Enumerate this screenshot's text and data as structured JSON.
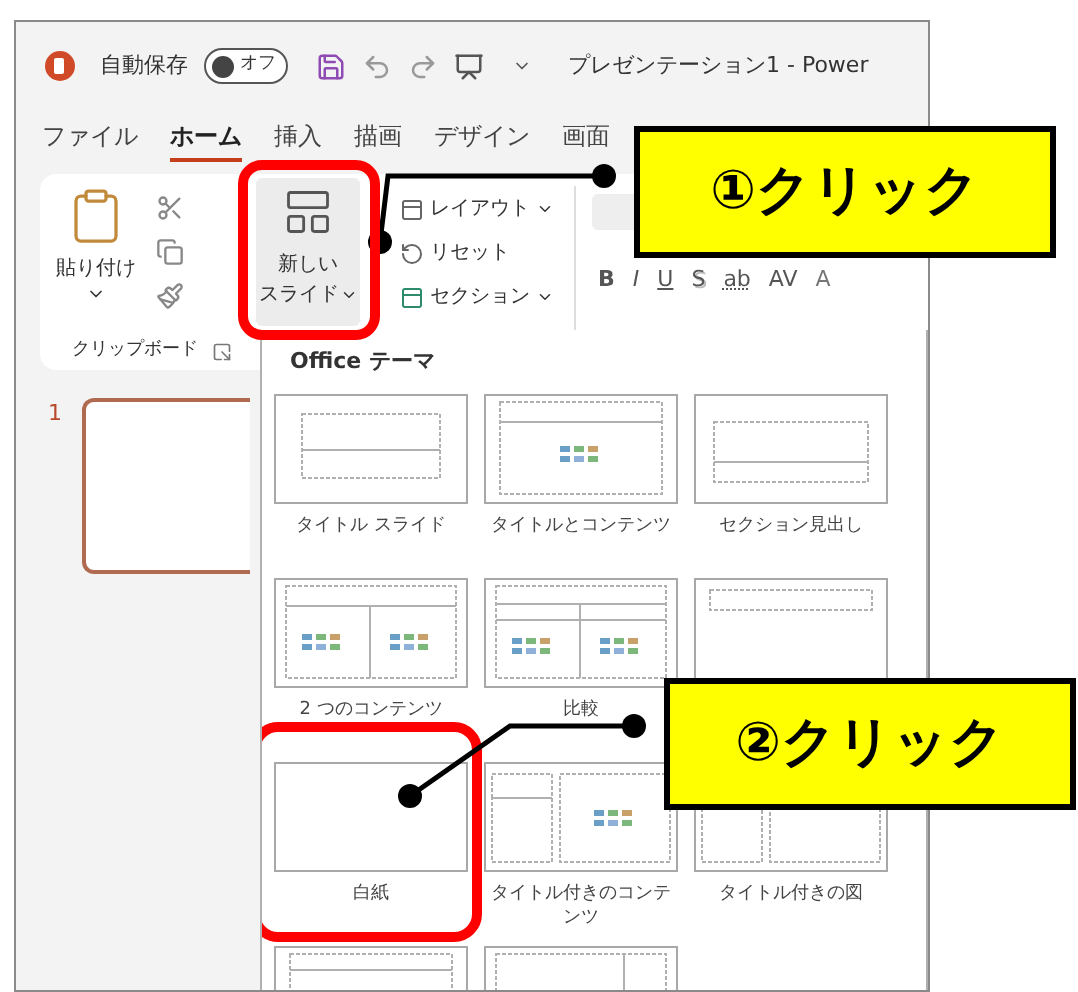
{
  "title_bar": {
    "autosave_label": "自動保存",
    "autosave_toggle": {
      "label": "オフ",
      "on": false
    },
    "document_title": "プレゼンテーション1 - Power"
  },
  "tabs": [
    {
      "label": "ファイル",
      "selected": false
    },
    {
      "label": "ホーム",
      "selected": true
    },
    {
      "label": "挿入",
      "selected": false
    },
    {
      "label": "描画",
      "selected": false
    },
    {
      "label": "デザイン",
      "selected": false
    },
    {
      "label": "画面",
      "selected": false
    }
  ],
  "clipboard_group": {
    "paste_label": "貼り付け",
    "group_label": "クリップボード"
  },
  "slides_group": {
    "new_slide": {
      "label_lines": [
        "新しい",
        "スライド"
      ],
      "highlighted": true
    },
    "commands": [
      {
        "label": "レイアウト",
        "dropdown": true
      },
      {
        "label": "リセット",
        "dropdown": false
      },
      {
        "label": "セクション",
        "dropdown": true
      }
    ]
  },
  "font_group": {
    "buttons": [
      {
        "label": "B",
        "kind": "bold"
      },
      {
        "label": "I",
        "kind": "italic"
      },
      {
        "label": "U",
        "kind": "underline"
      },
      {
        "label": "S",
        "kind": "shadow"
      },
      {
        "label": "ab",
        "kind": "strikethrough"
      },
      {
        "label": "AV",
        "kind": "spacing"
      },
      {
        "label": "A",
        "kind": "color"
      }
    ]
  },
  "slide_pane": {
    "slides": [
      {
        "number": "1",
        "selected": true
      }
    ]
  },
  "layout_gallery": {
    "title": "Office テーマ",
    "layouts": [
      {
        "kind": "title",
        "label": "タイトル スライド",
        "highlighted": false
      },
      {
        "kind": "title_content",
        "label": "タイトルとコンテンツ",
        "highlighted": false
      },
      {
        "kind": "section",
        "label": "セクション見出し",
        "highlighted": false
      },
      {
        "kind": "two_content",
        "label": "2 つのコンテンツ",
        "highlighted": false
      },
      {
        "kind": "comparison",
        "label": "比較",
        "highlighted": false
      },
      {
        "kind": "title_only",
        "highlighted": false
      },
      {
        "kind": "blank",
        "label": "白紙",
        "highlighted": true
      },
      {
        "kind": "content_caption",
        "label": "タイトル付きのコンテンツ",
        "highlighted": false
      },
      {
        "kind": "picture_caption",
        "label": "タイトル付きの図",
        "highlighted": false
      },
      {
        "kind": "vertical_text",
        "highlighted": false
      },
      {
        "kind": "vertical_title",
        "highlighted": false
      }
    ]
  },
  "callouts": [
    {
      "text": "①クリック"
    },
    {
      "text": "②クリック"
    }
  ]
}
